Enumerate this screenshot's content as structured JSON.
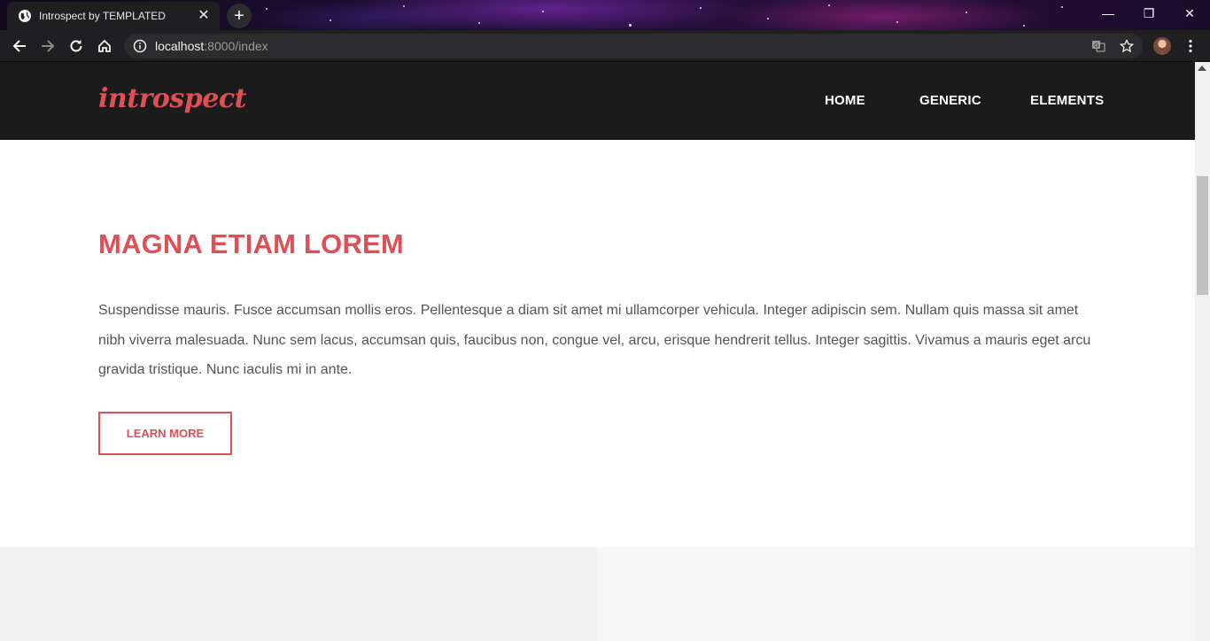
{
  "browser": {
    "tab_title": "Introspect by TEMPLATED",
    "tab_close": "✕",
    "new_tab": "+",
    "url_host": "localhost",
    "url_rest": ":8000/index",
    "window_controls": {
      "minimize": "—",
      "restore": "❐",
      "close": "✕"
    }
  },
  "site": {
    "logo": "introspect",
    "nav": [
      "HOME",
      "GENERIC",
      "ELEMENTS"
    ]
  },
  "banner": {
    "title": "MAGNA ETIAM LOREM",
    "text": "Suspendisse mauris. Fusce accumsan mollis eros. Pellentesque a diam sit amet mi ullamcorper vehicula. Integer adipiscin sem. Nullam quis massa sit amet nibh viverra malesuada. Nunc sem lacus, accumsan quis, faucibus non, congue vel, arcu, erisque hendrerit tellus. Integer sagittis. Vivamus a mauris eget arcu gravida tristique. Nunc iaculis mi in ante.",
    "button": "LEARN MORE"
  },
  "colors": {
    "accent": "#e04f55",
    "header_bg": "#1b1b1b",
    "chrome_bg": "#1f1f21"
  },
  "icons": [
    "globe-icon",
    "back-icon",
    "forward-icon",
    "reload-icon",
    "home-icon",
    "info-icon",
    "translate-icon",
    "star-icon",
    "profile-avatar",
    "menu-icon"
  ]
}
